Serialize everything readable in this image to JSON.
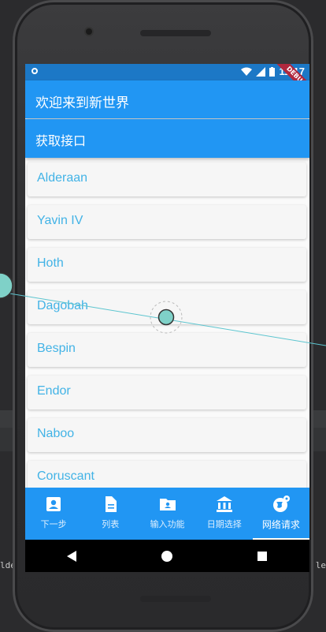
{
  "ide": {
    "left_text": "lde",
    "right_text": "le"
  },
  "status_bar": {
    "time": "11:17",
    "debug_label": "DEBUG"
  },
  "app_bar": {
    "title": "欢迎来到新世界"
  },
  "fetch_button": {
    "label": "获取接口"
  },
  "planets": [
    "Alderaan",
    "Yavin IV",
    "Hoth",
    "Dagobah",
    "Bespin",
    "Endor",
    "Naboo",
    "Coruscant"
  ],
  "bottom_nav": {
    "tabs": [
      {
        "label": "下一步",
        "icon": "account-box-icon"
      },
      {
        "label": "列表",
        "icon": "document-icon"
      },
      {
        "label": "输入功能",
        "icon": "contact-folder-icon"
      },
      {
        "label": "日期选择",
        "icon": "bank-icon"
      },
      {
        "label": "网络请求",
        "icon": "public-network-icon"
      }
    ],
    "active_index": 4
  },
  "colors": {
    "primary": "#2196f3",
    "status_bar": "#1c78c6",
    "list_text": "#42b3e6",
    "touch_marker": "#7fd1c8"
  }
}
